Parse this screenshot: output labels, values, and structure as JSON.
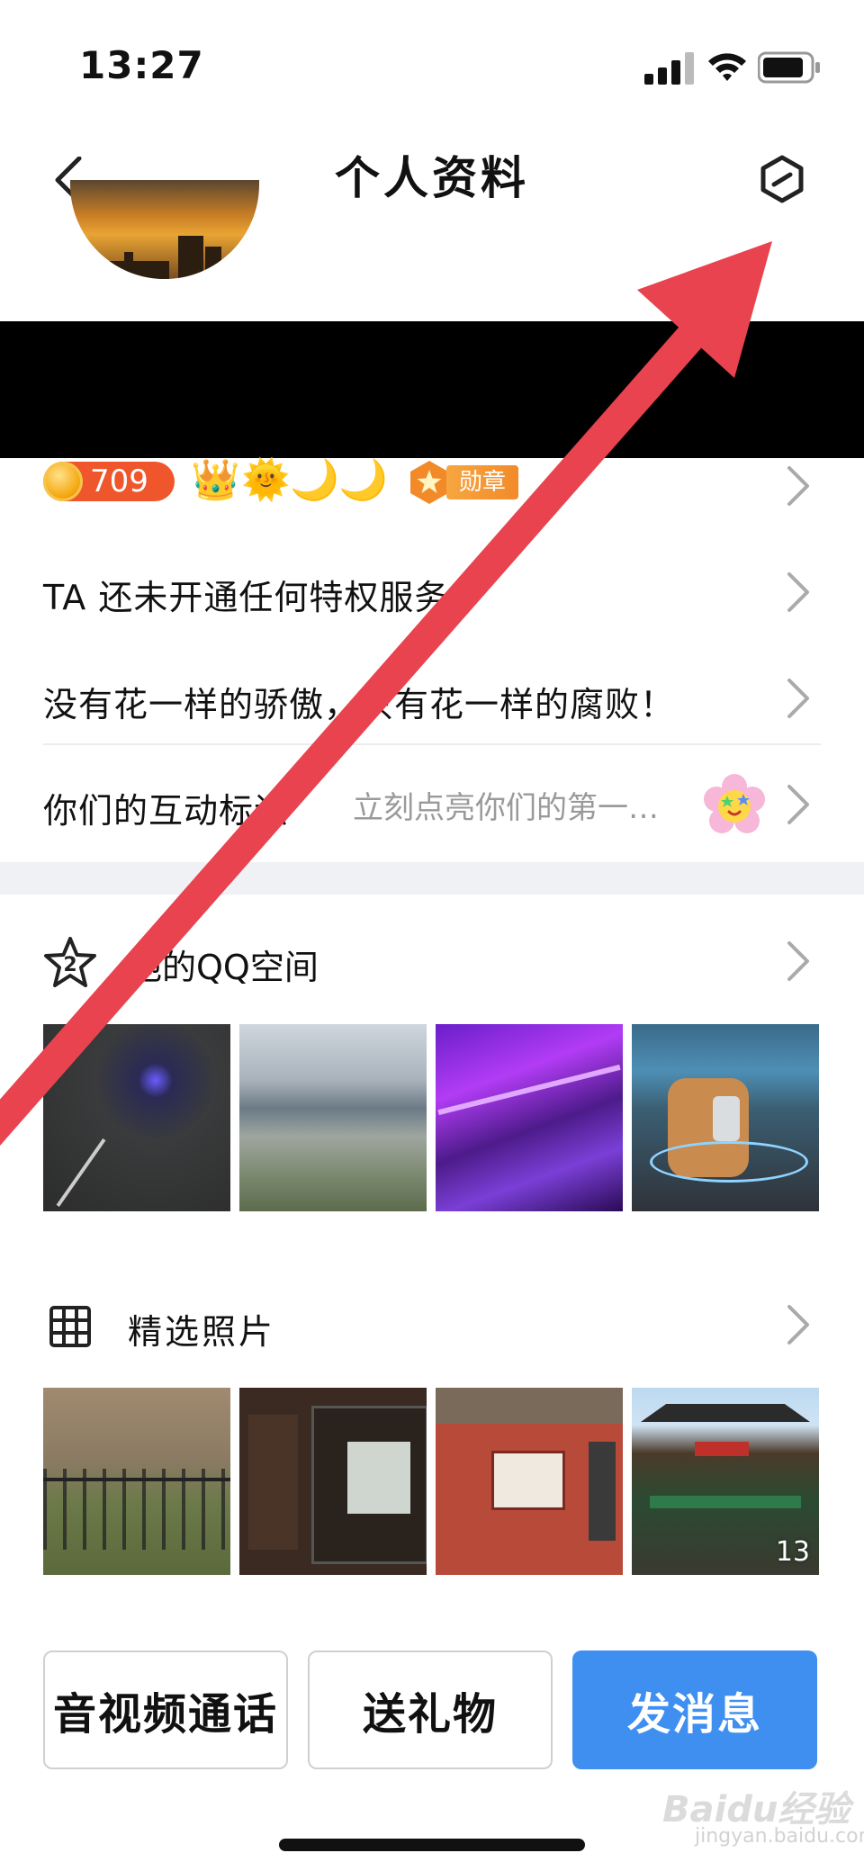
{
  "status_bar": {
    "time": "13:27"
  },
  "nav": {
    "title": "个人资料"
  },
  "badges": {
    "coin_count": "709",
    "level_icons": [
      "👑",
      "🌞",
      "🌙",
      "🌙"
    ],
    "medal_label": "勋章"
  },
  "rows": {
    "privilege": "TA 还未开通任何特权服务",
    "signature": "没有花一样的骄傲，只有花一样的腐败！",
    "interaction_label": "你们的互动标识",
    "interaction_hint": "立刻点亮你们的第一…"
  },
  "qzone": {
    "title": "他的QQ空间",
    "star_level": "2"
  },
  "photos": {
    "title": "精选照片",
    "count": "13"
  },
  "actions": {
    "call": "音视频通话",
    "gift": "送礼物",
    "message": "发消息"
  },
  "watermark": {
    "brand": "Baidu经验",
    "url": "jingyan.baidu.com"
  },
  "colors": {
    "accent_blue": "#3e8ff0",
    "arrow_red": "#e8434f",
    "coin_orange": "#f0562b",
    "medal_orange": "#f28a2a"
  }
}
